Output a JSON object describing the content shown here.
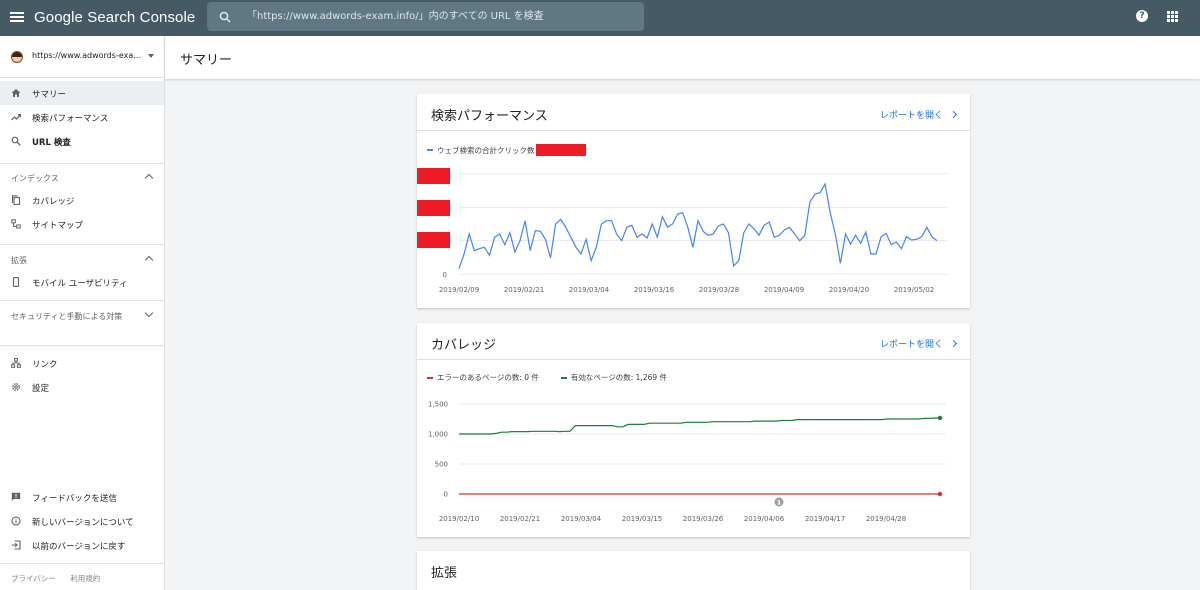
{
  "app": {
    "title": "Google Search Console",
    "search_placeholder": "「https://www.adwords-exam.info/」内のすべての URL を検査"
  },
  "sidebar": {
    "property": "https://www.adwords-exam.info/",
    "items_top": [
      {
        "label": "サマリー",
        "icon": "home-icon",
        "active": true
      },
      {
        "label": "検索パフォーマンス",
        "icon": "trending-up-icon",
        "active": false
      },
      {
        "label": "URL 検査",
        "icon": "search-icon",
        "active": false
      }
    ],
    "sections": [
      {
        "label": "インデックス",
        "expanded": true,
        "items": [
          {
            "label": "カバレッジ",
            "icon": "copy-icon"
          },
          {
            "label": "サイトマップ",
            "icon": "sitemap-icon"
          }
        ]
      },
      {
        "label": "拡張",
        "expanded": true,
        "items": [
          {
            "label": "モバイル ユーザビリティ",
            "icon": "smartphone-icon"
          }
        ]
      },
      {
        "label": "セキュリティと手動による対策",
        "expanded": false,
        "items": []
      }
    ],
    "items_misc": [
      {
        "label": "リンク",
        "icon": "links-icon"
      },
      {
        "label": "設定",
        "icon": "gear-icon"
      }
    ],
    "items_bottom": [
      {
        "label": "フィードバックを送信",
        "icon": "feedback-icon"
      },
      {
        "label": "新しいバージョンについて",
        "icon": "info-icon"
      },
      {
        "label": "以前のバージョンに戻す",
        "icon": "exit-icon"
      }
    ],
    "footer": {
      "privacy": "プライバシー",
      "terms": "利用規約"
    }
  },
  "page": {
    "title": "サマリー"
  },
  "cards": {
    "performance": {
      "title": "検索パフォーマンス",
      "link": "レポートを開く",
      "legend": "ウェブ検索の合計クリック数",
      "color": "#4285f4"
    },
    "coverage": {
      "title": "カバレッジ",
      "link": "レポートを開く",
      "legend_error": "エラーのあるページの数: 0 件",
      "legend_valid": "有効なページの数: 1,269 件",
      "error_color": "#d93025",
      "valid_color": "#188038",
      "annotation": "1"
    },
    "enhancements": {
      "title": "拡張"
    }
  },
  "chart_data": [
    {
      "type": "line",
      "title": "",
      "series": [
        {
          "name": "ウェブ検索の合計クリック数",
          "values": [
            8,
            30,
            60,
            35,
            38,
            40,
            28,
            55,
            60,
            44,
            62,
            33,
            50,
            80,
            35,
            65,
            64,
            52,
            24,
            75,
            82,
            70,
            55,
            40,
            30,
            52,
            20,
            40,
            75,
            80,
            80,
            60,
            50,
            70,
            73,
            55,
            60,
            54,
            75,
            55,
            86,
            70,
            75,
            90,
            92,
            70,
            40,
            80,
            64,
            58,
            60,
            72,
            75,
            62,
            12,
            20,
            62,
            75,
            68,
            58,
            73,
            78,
            55,
            58,
            66,
            70,
            60,
            50,
            58,
            108,
            120,
            122,
            135,
            92,
            60,
            16,
            60,
            45,
            58,
            46,
            63,
            30,
            30,
            56,
            61,
            44,
            48,
            38,
            56,
            51,
            52,
            56,
            70,
            56,
            50
          ]
        }
      ],
      "x_tick_labels": [
        "2019/02/09",
        "2019/02/21",
        "2019/03/04",
        "2019/03/16",
        "2019/03/28",
        "2019/04/09",
        "2019/04/20",
        "2019/05/02"
      ],
      "y_tick_labels": [
        "0"
      ],
      "grid": true
    },
    {
      "type": "line",
      "title": "",
      "series": [
        {
          "name": "エラーのあるページの数",
          "values": [
            0,
            0,
            0,
            0,
            0,
            0,
            0,
            0,
            0,
            0,
            0,
            0,
            0,
            0,
            0,
            0,
            0,
            0,
            0,
            0,
            0,
            0,
            0,
            0,
            0,
            0,
            0,
            0,
            0,
            0,
            0,
            0,
            0,
            0,
            0,
            0,
            0,
            0,
            0,
            0,
            0,
            0,
            0,
            0,
            0,
            0,
            0,
            0,
            0,
            0,
            0,
            0,
            0,
            0,
            0,
            0,
            0,
            0,
            0,
            0,
            0,
            0,
            0,
            0,
            0,
            0,
            0,
            0,
            0,
            0,
            0,
            0,
            0,
            0,
            0,
            0,
            0,
            0,
            0,
            0,
            0,
            0,
            0,
            0,
            0,
            0,
            0,
            0,
            0,
            0,
            0
          ]
        },
        {
          "name": "有効なページの数",
          "values": [
            1000,
            1000,
            1000,
            1000,
            1000,
            1000,
            1000,
            1010,
            1030,
            1030,
            1040,
            1040,
            1040,
            1040,
            1045,
            1045,
            1045,
            1045,
            1045,
            1040,
            1045,
            1045,
            1140,
            1140,
            1140,
            1140,
            1140,
            1140,
            1140,
            1140,
            1120,
            1120,
            1160,
            1160,
            1160,
            1160,
            1180,
            1180,
            1180,
            1180,
            1180,
            1180,
            1180,
            1195,
            1195,
            1195,
            1195,
            1195,
            1205,
            1205,
            1205,
            1205,
            1205,
            1205,
            1205,
            1205,
            1215,
            1215,
            1215,
            1215,
            1215,
            1225,
            1225,
            1225,
            1240,
            1240,
            1240,
            1240,
            1240,
            1240,
            1240,
            1240,
            1240,
            1240,
            1240,
            1240,
            1240,
            1240,
            1240,
            1240,
            1240,
            1250,
            1250,
            1250,
            1250,
            1250,
            1250,
            1250,
            1260,
            1260,
            1265,
            1269
          ]
        }
      ],
      "x_tick_labels": [
        "2019/02/10",
        "2019/02/21",
        "2019/03/04",
        "2019/03/15",
        "2019/03/26",
        "2019/04/06",
        "2019/04/17",
        "2019/04/28"
      ],
      "y_tick_labels": [
        "0",
        "500",
        "1,000",
        "1,500"
      ],
      "ylim": [
        0,
        1500
      ],
      "grid": true
    }
  ]
}
